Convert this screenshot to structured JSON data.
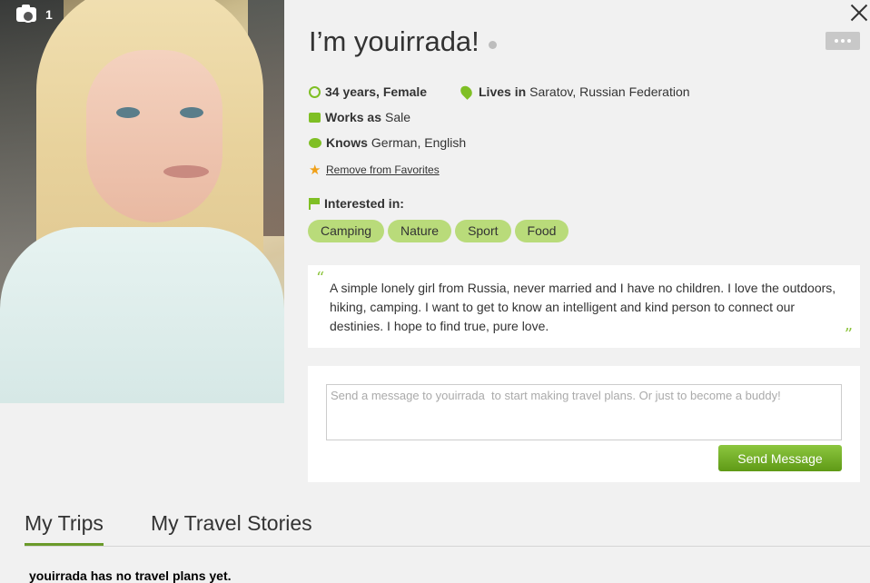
{
  "photo": {
    "count": "1"
  },
  "profile": {
    "title": "I’m youirrada!",
    "age": "34 years, Female",
    "lives_label": "Lives in",
    "lives_value": "Saratov, Russian Federation",
    "works_label": "Works as",
    "works_value": "Sale",
    "knows_label": "Knows",
    "knows_value": "German, English",
    "favorite_link": "Remove from Favorites",
    "interested_label": "Interested in:",
    "interests": [
      "Camping",
      "Nature",
      "Sport",
      "Food"
    ],
    "bio": "A simple lonely girl from Russia, never married and I have no children. I love the outdoors, hiking, camping. I want to get to know an intelligent and kind person to connect our destinies. I hope to find true, pure love.",
    "quote_open": "“",
    "quote_close": "”"
  },
  "message": {
    "placeholder": "Send a message to youirrada  to start making travel plans. Or just to become a buddy!",
    "send_label": "Send Message"
  },
  "tabs": [
    {
      "label": "My Trips",
      "active": true
    },
    {
      "label": "My Travel Stories",
      "active": false
    }
  ],
  "trips": {
    "empty_text": "youirrada has no travel plans yet."
  },
  "colors": {
    "accent": "#7fbf24",
    "tag_bg": "#b9db7a",
    "star": "#f0a018"
  },
  "icons": [
    "camera-icon",
    "close-icon",
    "more-icon",
    "age-icon",
    "location-icon",
    "work-icon",
    "language-icon",
    "star-icon",
    "flag-icon"
  ]
}
